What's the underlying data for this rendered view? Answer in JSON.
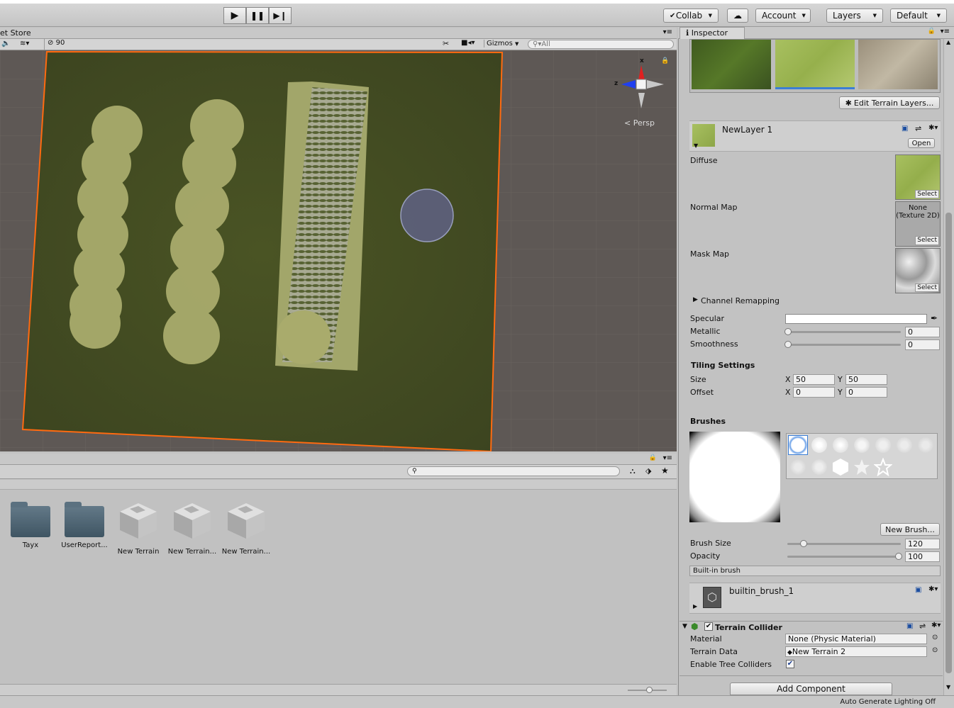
{
  "toolbar": {
    "collab_label": "Collab",
    "account_label": "Account",
    "layers_label": "Layers",
    "layout_label": "Default"
  },
  "scene": {
    "tab_label": "et Store",
    "hidden_count": "90",
    "gizmos_label": "Gizmos",
    "search_placeholder": "All",
    "persp_label": "Persp",
    "axis_x": "x",
    "axis_z": "z"
  },
  "project": {
    "assets": [
      {
        "label": "Tayx",
        "kind": "folder"
      },
      {
        "label": "UserReport...",
        "kind": "folder"
      },
      {
        "label": "New Terrain",
        "kind": "terrain"
      },
      {
        "label": "New Terrain...",
        "kind": "terrain"
      },
      {
        "label": "New Terrain...",
        "kind": "terrain"
      }
    ]
  },
  "inspector": {
    "tab_label": "Inspector",
    "edit_layers_label": "Edit Terrain Layers...",
    "layer_name": "NewLayer 1",
    "open_label": "Open",
    "diffuse_label": "Diffuse",
    "normal_map_label": "Normal Map",
    "normal_map_value": "None (Texture 2D)",
    "mask_map_label": "Mask Map",
    "select_label": "Select",
    "channel_remapping_label": "Channel Remapping",
    "specular_label": "Specular",
    "metallic_label": "Metallic",
    "metallic_value": "0",
    "smoothness_label": "Smoothness",
    "smoothness_value": "0",
    "tiling_header": "Tiling Settings",
    "size_label": "Size",
    "offset_label": "Offset",
    "x_label": "X",
    "y_label": "Y",
    "size_x": "50",
    "size_y": "50",
    "offset_x": "0",
    "offset_y": "0",
    "brushes_header": "Brushes",
    "new_brush_label": "New Brush...",
    "brush_size_label": "Brush Size",
    "brush_size_value": "120",
    "brush_size_fraction": 0.14,
    "opacity_label": "Opacity",
    "opacity_value": "100",
    "opacity_fraction": 1.0,
    "builtin_label": "Built-in brush",
    "brush_name": "builtin_brush_1",
    "collider_label": "Terrain Collider",
    "material_label": "Material",
    "material_value": "None (Physic Material)",
    "terrain_data_label": "Terrain Data",
    "terrain_data_value": "New Terrain 2",
    "tree_colliders_label": "Enable Tree Colliders",
    "add_component_label": "Add Component"
  },
  "status": {
    "lighting_label": "Auto Generate Lighting Off"
  }
}
